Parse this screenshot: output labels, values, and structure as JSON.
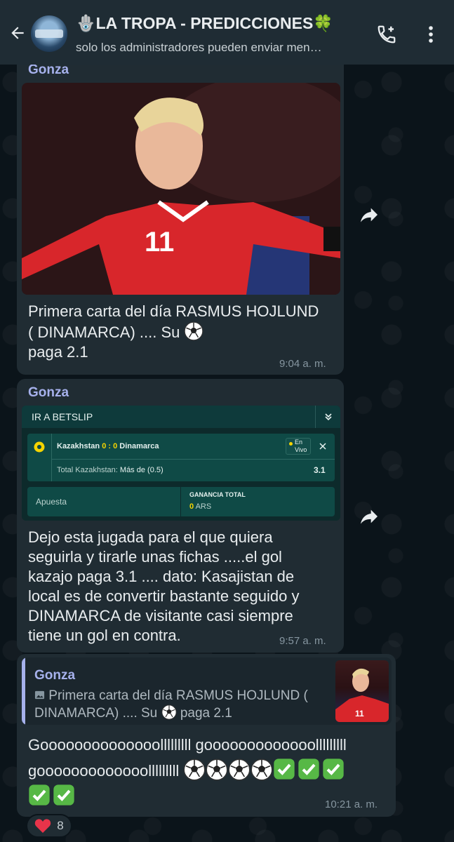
{
  "header": {
    "title": "🪬LA TROPA - PREDICCIONES🍀",
    "subtitle": "solo los administradores pueden enviar men…"
  },
  "messages": [
    {
      "sender": "Gonza",
      "text": "Primera carta del día RASMUS HOJLUND ( DINAMARCA) .... Su",
      "text_tail": "paga 2.1",
      "time": "9:04 a. m."
    },
    {
      "sender": "Gonza",
      "betslip": {
        "header": "IR A BETSLIP",
        "team_home": "Kazakhstan",
        "score": "0 : 0",
        "team_away": "Dinamarca",
        "status_line1": "En",
        "status_line2": "Vivo",
        "market_label": "Total Kazakhstan:",
        "market_value": "Más de (0.5)",
        "odds": "3.1",
        "stake_label": "Apuesta",
        "gain_label": "GANANCIA TOTAL",
        "gain_value": "0",
        "currency": "ARS"
      },
      "text": "Dejo esta jugada para el que quiera seguirla y tirarle unas fichas .....el gol kazajo paga 3.1 .... dato: Kasajistan de local es de convertir bastante seguido y DINAMARCA de visitante casi siempre tiene un gol en contra.",
      "time": "9:57 a. m."
    },
    {
      "quote_sender": "Gonza",
      "quote_text": "Primera carta del día RASMUS HOJLUND ( DINAMARCA) .... Su",
      "quote_tail": "paga 2.1",
      "text_line1": "Goooooooooooooolllllllll gooooooooooooolllllllll",
      "text_line2": "gooooooooooooolllllllll",
      "time": "10:21 a. m.",
      "reaction_count": "8"
    }
  ],
  "icons": {
    "back": "arrow-left-icon",
    "call": "call-add-icon",
    "menu": "more-vertical-icon",
    "forward": "forward-icon",
    "ball": "soccer-ball-icon",
    "check": "check-mark-icon",
    "heart": "heart-icon"
  },
  "colors": {
    "header_bg": "#1f2c34",
    "chat_bg": "#0b141a",
    "bubble_bg": "#202c33",
    "sender": "#a6b1ec",
    "time": "#8696a0",
    "betslip_accent": "#f5d400"
  }
}
